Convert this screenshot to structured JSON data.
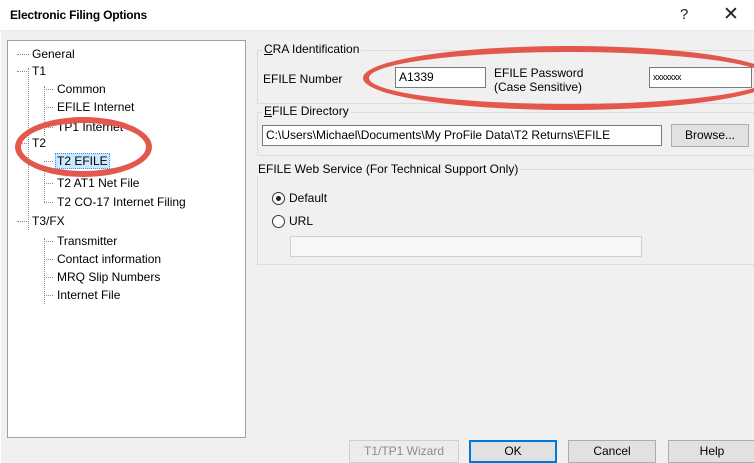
{
  "window": {
    "title": "Electronic Filing Options",
    "help_symbol": "?",
    "close_symbol": "✕"
  },
  "tree": {
    "items": [
      {
        "label": "General"
      },
      {
        "label": "T1"
      },
      {
        "label": "Common"
      },
      {
        "label": "EFILE Internet"
      },
      {
        "label": "TP1 Internet"
      },
      {
        "label": "T2"
      },
      {
        "label": "T2 EFILE",
        "selected": true
      },
      {
        "label": "T2 AT1 Net File"
      },
      {
        "label": "T2 CO-17 Internet Filing"
      },
      {
        "label": "T3/FX"
      },
      {
        "label": "Transmitter"
      },
      {
        "label": "Contact information"
      },
      {
        "label": "MRQ Slip Numbers"
      },
      {
        "label": "Internet File"
      }
    ]
  },
  "cra": {
    "group_title_mnemonic": "C",
    "group_title_rest": "RA Identification",
    "efile_number_label": "EFILE Number",
    "efile_number_value": "A1339",
    "password_label_line1": "EFILE Password",
    "password_label_line2": "(Case Sensitive)",
    "password_value": "xxxxxxx"
  },
  "directory": {
    "group_title_mnemonic": "E",
    "group_title_rest": "FILE Directory",
    "path": "C:\\Users\\Michael\\Documents\\My ProFile Data\\T2 Returns\\EFILE",
    "browse_label": "Browse..."
  },
  "web_service": {
    "group_title": "EFILE Web Service (For Technical Support Only)",
    "options": [
      {
        "label": "Default",
        "selected": true
      },
      {
        "label": "URL",
        "selected": false
      }
    ],
    "url_value": ""
  },
  "buttons": {
    "wizard": "T1/TP1 Wizard",
    "ok": "OK",
    "cancel": "Cancel",
    "help": "Help"
  },
  "colors": {
    "annotation": "#e4574d",
    "selection": "#cce8ff",
    "default_button_border": "#0078d7"
  }
}
